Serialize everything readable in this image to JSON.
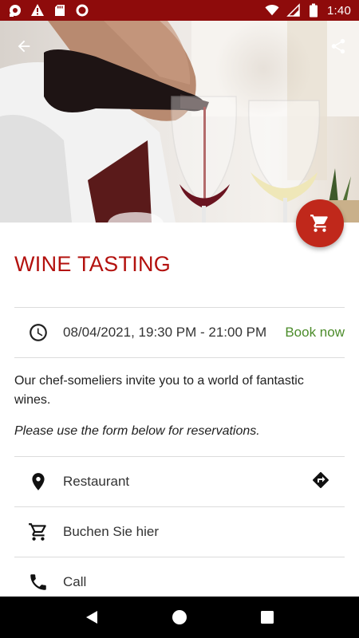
{
  "status_bar": {
    "time": "1:40",
    "color": "#8e0b0b",
    "left_icons": [
      "notification-icon",
      "warning-icon",
      "sd-card-icon",
      "record-icon"
    ],
    "right_icons": [
      "wifi-icon",
      "cell-signal-icon",
      "battery-icon"
    ]
  },
  "hero": {
    "image": "wine-pouring-photo",
    "back_icon": "arrow-back-icon",
    "share_icon": "share-icon"
  },
  "fab": {
    "icon": "cart-icon",
    "color": "#c0281b"
  },
  "event": {
    "title": "WINE TASTING",
    "datetime": "08/04/2021, 19:30 PM - 21:00 PM",
    "book_label": "Book now",
    "description": "Our chef-someliers invite you to a world of fantastic wines.",
    "note": "Please use the form below for reservations."
  },
  "actions": [
    {
      "icon": "location-pin-icon",
      "label": "Restaurant",
      "trailing_icon": "directions-icon"
    },
    {
      "icon": "cart-icon",
      "label": "Buchen Sie hier"
    },
    {
      "icon": "phone-icon",
      "label": "Call"
    }
  ],
  "colors": {
    "accent": "#b3110e",
    "book_now": "#4c8c2b"
  },
  "nav": {
    "icons": [
      "back-triangle-icon",
      "home-circle-icon",
      "recents-square-icon"
    ]
  }
}
